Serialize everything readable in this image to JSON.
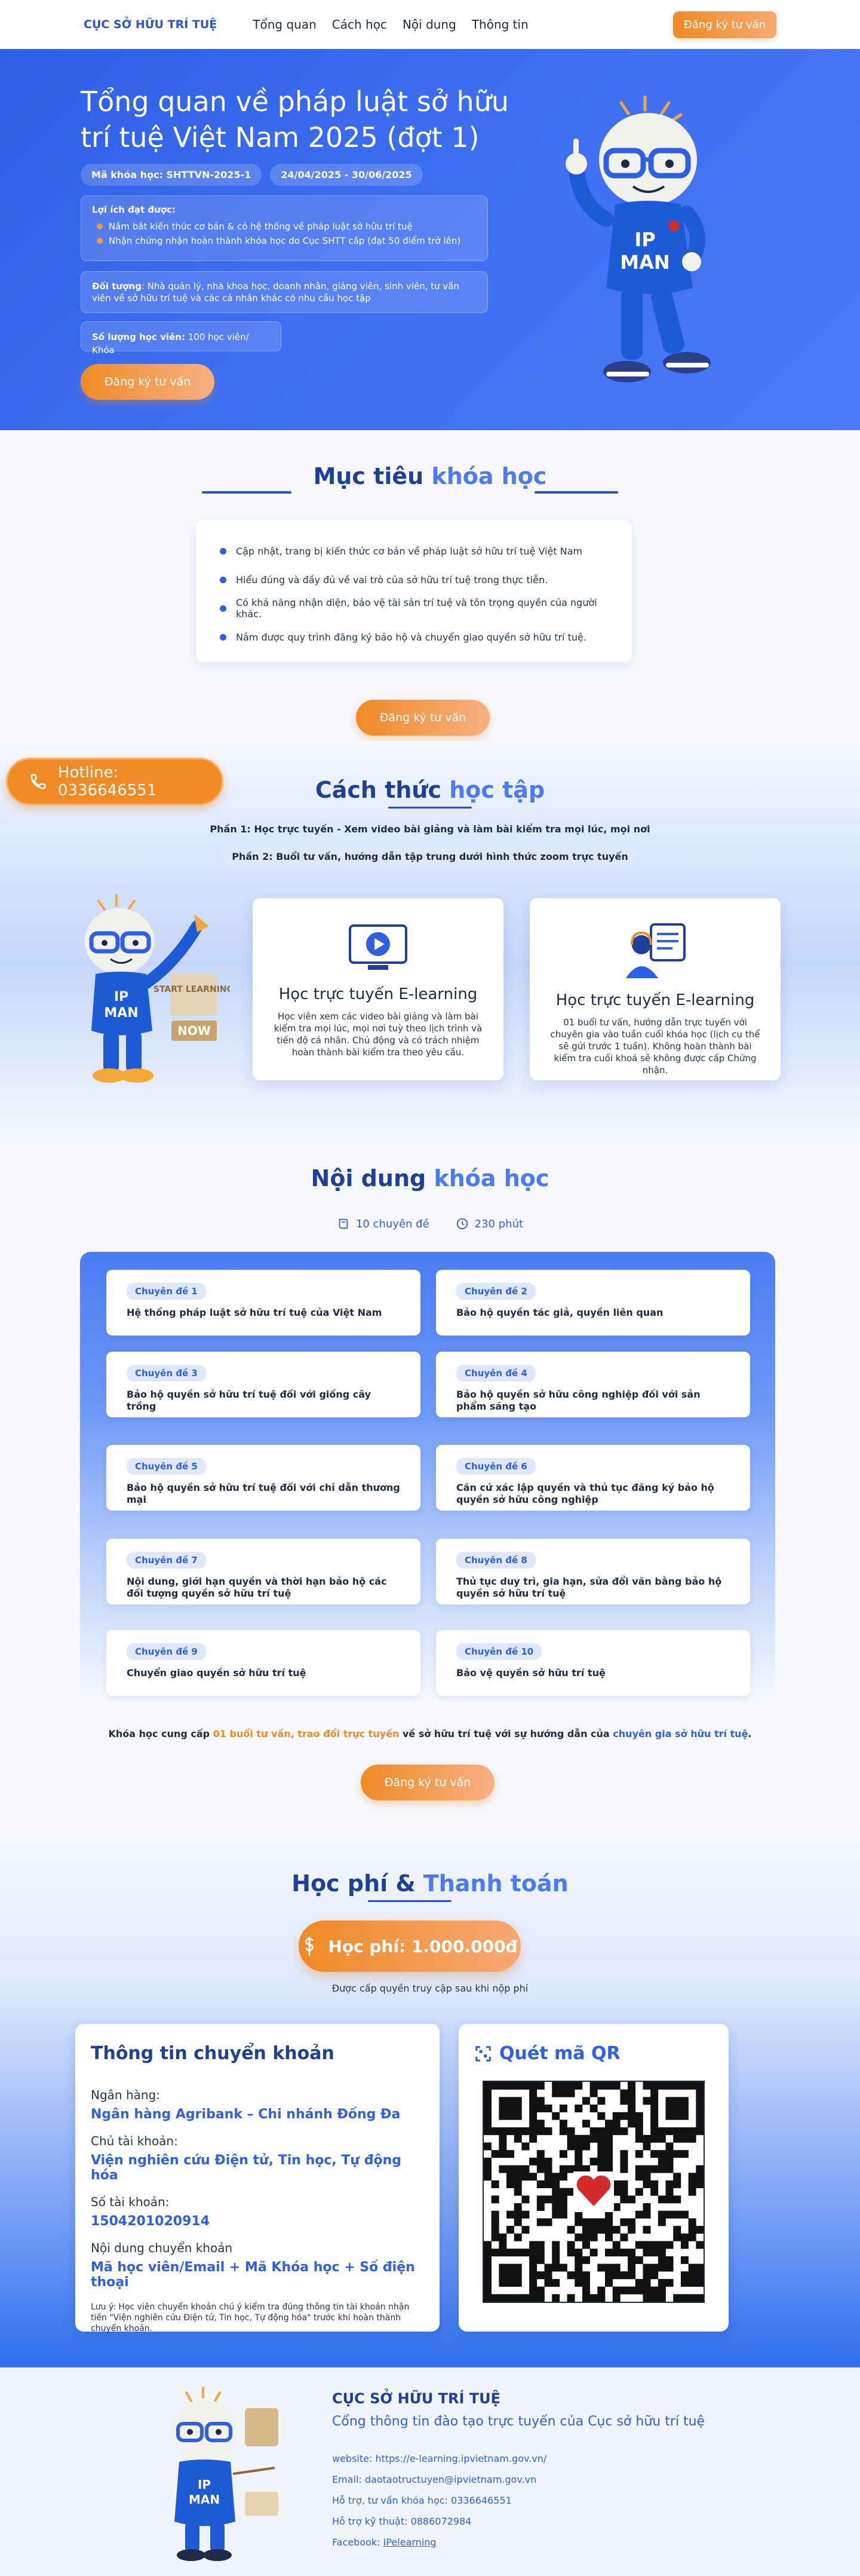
{
  "header": {
    "logo": "CỤC SỞ HỮU TRÍ TUỆ",
    "nav": [
      "Tổng quan",
      "Cách học",
      "Nội dung",
      "Thông tin"
    ],
    "cta": "Đăng ký tư vấn"
  },
  "hero": {
    "title": "Tổng quan về pháp luật sở hữu trí tuệ Việt Nam 2025 (đợt 1)",
    "code": "Mã khóa học: SHTTVN-2025-1",
    "dates": "24/04/2025 - 30/06/2025",
    "benefits_title": "Lợi ích đạt được:",
    "benefits": [
      "Nắm bắt kiến thức cơ bản & có hệ thống về pháp luật sở hữu trí tuệ",
      "Nhận chứng nhận hoàn thành khóa học do Cục SHTT cấp (đạt 50 điểm trở lên)"
    ],
    "audience_label": "Đối tượng",
    "audience_text": ": Nhà quản lý, nhà khoa học, doanh nhân, giảng viên, sinh viên, tư vấn viên về sở hữu trí tuệ và các cá nhân khác có nhu cầu học tập",
    "capacity_label": "Số lượng học viên:",
    "capacity_text": " 100 học viên/ Khóa",
    "cta": "Đăng ký tư vấn",
    "mascot_text": "IP MAN"
  },
  "goals": {
    "title_a": "Mục tiêu",
    "title_b": "khóa học",
    "items": [
      "Cập nhật, trang bị kiến thức cơ bản về pháp luật sở hữu trí tuệ Việt Nam",
      "Hiểu đúng và đầy đủ về vai trò của sở hữu trí tuệ trong thực tiễn.",
      "Có khả năng nhận diện, bảo vệ tài sản trí tuệ và tôn trọng quyền của người khác.",
      "Nắm được quy trình đăng ký bảo hộ và chuyển giao quyền sở hữu trí tuệ."
    ],
    "cta": "Đăng ký tư vấn"
  },
  "hotline": "Hotline: 0336646551",
  "learning": {
    "title_a": "Cách thức",
    "title_b": "học tập",
    "phase1": "Phần 1: Học trực tuyến - Xem video bài giảng và làm bài kiểm tra mọi lúc, mọi nơi",
    "phase2": "Phần 2: Buổi tư vấn, hướng dẫn tập trung dưới hình thức zoom trực tuyến",
    "badge_start": "START LEARNING",
    "badge_now": "NOW",
    "cards": [
      {
        "title": "Học trực tuyến E-learning",
        "text": "Học viên xem các video bài giảng và làm bài kiểm tra mọi lúc, mọi nơi tuỳ theo lịch trình và tiến độ cá nhân. Chủ động và có trách nhiệm hoàn thành bài kiểm tra theo yêu cầu."
      },
      {
        "title": "Học trực tuyến E-learning",
        "text": "01 buổi tư vấn, hướng dẫn trực tuyến với chuyên gia vào tuần cuối khóa học (lịch cụ thể sẽ gửi trước 1 tuần). Không hoàn thành bài kiểm tra cuối khoá sẽ không được cấp Chứng nhận."
      }
    ]
  },
  "content": {
    "title_a": "Nội dung",
    "title_b": "khóa học",
    "topics_count": "10 chuyên đề",
    "minutes": "230 phút",
    "topics": [
      {
        "chip": "Chuyên đề 1",
        "title": "Hệ thống pháp luật sở hữu trí tuệ của Việt Nam"
      },
      {
        "chip": "Chuyên đề 2",
        "title": "Bảo hộ quyền tác giả, quyền liên quan"
      },
      {
        "chip": "Chuyên đề 3",
        "title": "Bảo hộ quyền sở hữu trí tuệ đối với giống cây trồng"
      },
      {
        "chip": "Chuyên đề 4",
        "title": "Bảo hộ quyền sở hữu công nghiệp đối với sản phẩm sáng tạo"
      },
      {
        "chip": "Chuyên đề 5",
        "title": "Bảo hộ quyền sở hữu trí tuệ đối với chỉ dẫn thương mại"
      },
      {
        "chip": "Chuyên đề 6",
        "title": "Căn cứ xác lập quyền và thủ tục đăng ký bảo hộ quyền sở hữu công nghiệp"
      },
      {
        "chip": "Chuyên đề 7",
        "title": "Nội dung, giới hạn quyền và thời hạn bảo hộ các đối tượng quyền sở hữu trí tuệ"
      },
      {
        "chip": "Chuyên đề 8",
        "title": "Thủ tục duy trì, gia hạn, sửa đổi văn bằng bảo hộ quyền sở hữu trí tuệ"
      },
      {
        "chip": "Chuyên đề 9",
        "title": "Chuyển giao quyền sở hữu trí tuệ"
      },
      {
        "chip": "Chuyên đề 10",
        "title": "Bảo vệ quyền sở hữu trí tuệ"
      }
    ],
    "note_a": "Khóa học cung cấp ",
    "note_b": "01 buổi tư vấn, trao đổi trực tuyến",
    "note_c": " về sở hữu trí tuệ với sự hướng dẫn của ",
    "note_d": "chuyên gia sở hữu trí tuệ",
    "note_e": ".",
    "cta": "Đăng ký tư vấn"
  },
  "fees": {
    "title_a": "Học phí &",
    "title_b": "Thanh toán",
    "price": "Học phí: 1.000.000đ",
    "sub": "Được cấp quyền truy cập sau khi nộp phí",
    "bank": {
      "title": "Thông tin chuyển khoản",
      "bank_label": "Ngân hàng:",
      "bank_value": "Ngân hàng Agribank – Chi nhánh Đống Đa",
      "owner_label": "Chủ tài khoản:",
      "owner_value": "Viện nghiên cứu Điện tử, Tin học, Tự động hóa",
      "account_label": "Số tài khoản:",
      "account_value": "1504201020914",
      "memo_label": "Nội dung chuyển khoản",
      "memo_value": "Mã học viên/Email + Mã Khóa học + Số điện thoại",
      "warning": "Lưu ý: Học viên chuyển khoản chú ý kiểm tra đúng thông tin tài khoản nhận tiền \"Viện nghiên cứu Điện tử, Tin học, Tự động hóa\" trước khi hoàn thành chuyển khoản."
    },
    "qr_title": "Quét mã QR"
  },
  "footer": {
    "title": "CỤC SỞ HỮU TRÍ TUỆ",
    "subtitle": "Cổng thông tin đào tạo trực tuyến của Cục sở hữu trí tuệ",
    "website": "website: https://e-learning.ipvietnam.gov.vn/",
    "email": "Email: daotaotructuyen@ipvietnam.gov.vn",
    "support": "Hỗ trợ, tư vấn khóa học: 0336646551",
    "tech": "Hỗ trợ kỹ thuật: 0886072984",
    "facebook_label": "Facebook: ",
    "facebook_link": "IPelearning"
  },
  "colors": {
    "primary": "#2f5fe4",
    "accent": "#ef8a25",
    "dark": "#1e3f9a"
  }
}
